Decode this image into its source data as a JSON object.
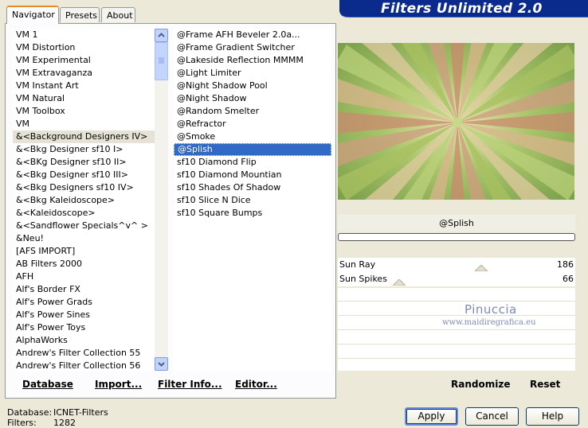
{
  "app": {
    "banner_title": "Filters Unlimited 2.0"
  },
  "tabs": [
    {
      "label": "Navigator"
    },
    {
      "label": "Presets"
    },
    {
      "label": "About"
    }
  ],
  "categories": [
    "VM 1",
    "VM Distortion",
    "VM Experimental",
    "VM Extravaganza",
    "VM Instant Art",
    "VM Natural",
    "VM Toolbox",
    "VM",
    "&<Background Designers IV>",
    "&<Bkg Designer sf10 I>",
    "&<BKg Designer sf10 II>",
    "&<Bkg Designer sf10 III>",
    "&<Bkg Designers sf10 IV>",
    "&<Bkg Kaleidoscope>",
    "&<Kaleidoscope>",
    "&<Sandflower Specials^v^ >",
    "&Neu!",
    "[AFS IMPORT]",
    "AB Filters 2000",
    "AFH",
    "Alf's Border FX",
    "Alf's Power Grads",
    "Alf's Power Sines",
    "Alf's Power Toys",
    "AlphaWorks",
    "Andrew's Filter Collection 55",
    "Andrew's Filter Collection 56"
  ],
  "filters": [
    "@Frame AFH Beveler 2.0a...",
    "@Frame Gradient Switcher",
    "@Lakeside Reflection MMMM",
    "@Light Limiter",
    "@Night Shadow Pool",
    "@Night Shadow",
    "@Random Smelter",
    "@Refractor",
    "@Smoke",
    "@Splish",
    "sf10 Diamond Flip",
    "sf10 Diamond Mountian",
    "sf10 Shades Of Shadow",
    "sf10 Slice N Dice",
    "sf10 Square Bumps"
  ],
  "selected_category_index": 8,
  "selected_filter_index": 9,
  "preview": {
    "filter_name": "@Splish"
  },
  "sliders": [
    {
      "label": "Sun Ray",
      "value": "186",
      "level": 186
    },
    {
      "label": "Sun Spikes",
      "value": "66",
      "level": 66
    }
  ],
  "watermark": {
    "name": "Pinuccia",
    "site": "www.maidiregrafica.eu"
  },
  "toolbar": {
    "database": "Database",
    "import": "Import...",
    "filter_info": "Filter Info...",
    "editor": "Editor...",
    "randomize": "Randomize",
    "reset": "Reset"
  },
  "status": {
    "database_label": "Database:",
    "database_value": "ICNET-Filters",
    "filters_label": "Filters:",
    "filters_value": "1282"
  },
  "dialog_buttons": {
    "apply": "Apply",
    "cancel": "Cancel",
    "help": "Help"
  },
  "colors": {
    "banner_bg": "#0a2a8c",
    "selection_blue": "#316ac5",
    "tab_accent": "#e68b2c"
  }
}
